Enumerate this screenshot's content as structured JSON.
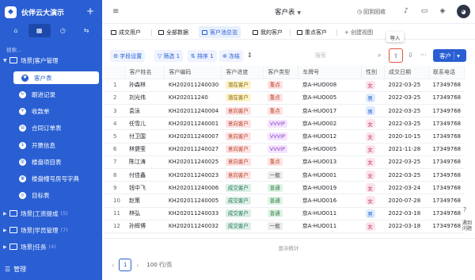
{
  "sidebar": {
    "brand": "伙伴云大演示",
    "logo_glyph": "◆",
    "plus": "+",
    "search_placeholder": "搜索...",
    "tabs": [
      {
        "icon": "home-icon",
        "glyph": "⌂"
      },
      {
        "icon": "table-icon",
        "glyph": "▦",
        "active": true
      },
      {
        "icon": "clock-icon",
        "glyph": "◷"
      },
      {
        "icon": "flow-icon",
        "glyph": "⇆"
      }
    ],
    "groups": [
      {
        "label": "场景|客户管理",
        "count": ""
      },
      {
        "label": "场景|工资提成",
        "count": "(5)"
      },
      {
        "label": "场景|学员管理",
        "count": "(7)"
      },
      {
        "label": "场景|任务",
        "count": "(4)"
      }
    ],
    "items": [
      {
        "label": "客户表",
        "icon": "heart-icon",
        "glyph": "♥"
      },
      {
        "label": "跟进记录",
        "icon": "refresh-icon",
        "glyph": "↻"
      },
      {
        "label": "收款单",
        "icon": "money-icon",
        "glyph": "¥"
      },
      {
        "label": "合同订单表",
        "icon": "document-icon",
        "glyph": "▤"
      },
      {
        "label": "开票信息",
        "icon": "invoice-icon",
        "glyph": "$"
      },
      {
        "label": "楼盘项目表",
        "icon": "building-icon",
        "glyph": "▥"
      },
      {
        "label": "楼盘幢号房号字典",
        "icon": "dictionary-icon",
        "glyph": "▦"
      },
      {
        "label": "目标表",
        "icon": "target-icon",
        "glyph": "◎"
      }
    ],
    "footer": "管理"
  },
  "topbar": {
    "title": "客户表",
    "recycle": "回到回收",
    "avatar": "◕"
  },
  "view_tabs": [
    "成交用户",
    "全部数据",
    "客户池总览",
    "我的客户",
    "重点客户",
    "+ 创建视图"
  ],
  "toolbar": {
    "field_settings": "字段设置",
    "filter": "筛选 1",
    "sort": "排序 1",
    "freeze": "冻结",
    "search_placeholder": "搜索",
    "import_tooltip": "导入",
    "customer_button": "客户"
  },
  "table": {
    "columns": [
      "",
      "客户姓名",
      "客户编码",
      "客户进度",
      "客户类型",
      "车牌号",
      "性别",
      "成交日期",
      "联系电话"
    ],
    "rows": [
      [
        "1",
        "孙森林",
        "KH202011240030",
        "潜在客户",
        "重点",
        "京A-HUO008",
        "女",
        "2022-03-25",
        "17349768"
      ],
      [
        "2",
        "刘光伟",
        "KH202011240",
        "潜在客户",
        "重点",
        "京A-HUO005",
        "男",
        "2022-03-25",
        "17349768"
      ],
      [
        "3",
        "袁泳",
        "KH202011240004",
        "意向客户",
        "重点",
        "京A-HUO017",
        "男",
        "2022-03-25",
        "17349768"
      ],
      [
        "4",
        "任雪儿",
        "KH202011240001",
        "意向客户",
        "VVVIP",
        "京A-HUO002",
        "女",
        "2022-03-25",
        "17349768"
      ],
      [
        "5",
        "付卫国",
        "KH202011240007",
        "意向客户",
        "VVVIP",
        "京A-HUO012",
        "女",
        "2020-10-15",
        "17349768"
      ],
      [
        "6",
        "林健莹",
        "KH202011240027",
        "意向客户",
        "VVVIP",
        "京A-HUO005",
        "女",
        "2021-11-28",
        "17349768"
      ],
      [
        "7",
        "陈江涛",
        "KH202011240025",
        "意向客户",
        "重点",
        "京A-HUO013",
        "女",
        "2022-03-25",
        "17349768"
      ],
      [
        "8",
        "付佳鑫",
        "KH202011240023",
        "意向客户",
        "一般",
        "京A-HUO001",
        "女",
        "2022-03-25",
        "17349768"
      ],
      [
        "9",
        "钱中飞",
        "KH202011240006",
        "成交客户",
        "普通",
        "京A-HUO019",
        "女",
        "2022-03-24",
        "17349768"
      ],
      [
        "10",
        "赵策",
        "KH202011240005",
        "成交客户",
        "普通",
        "京A-HUO016",
        "女",
        "2020-07-28",
        "17349768"
      ],
      [
        "11",
        "林弘",
        "KH202011240033",
        "成交客户",
        "普通",
        "京A-HUO011",
        "男",
        "2022-03-18",
        "17349768"
      ],
      [
        "12",
        "孙辉博",
        "KH202011240032",
        "成交客户",
        "一般",
        "京A-HUO011",
        "女",
        "2022-03-18",
        "17349768"
      ]
    ]
  },
  "colors": {
    "progress": {
      "潜在客户": [
        "#fdf3c9",
        "#8a6a0b"
      ],
      "意向客户": [
        "#fde2e2",
        "#b8472f"
      ],
      "成交客户": [
        "#dcefe6",
        "#2a7a5a"
      ]
    },
    "type": {
      "重点": [
        "#fde2e2",
        "#b8472f"
      ],
      "VVVIP": [
        "#f3e3ff",
        "#8a3fbf"
      ],
      "一般": [
        "#ececec",
        "#444"
      ],
      "普通": [
        "#dff3e3",
        "#2a7a4a"
      ]
    },
    "gender": {
      "女": [
        "#fde2ec",
        "#b83a66"
      ],
      "男": [
        "#dde9ff",
        "#2a5fd3"
      ]
    }
  },
  "footer": {
    "stats": "显示统计",
    "page": "1",
    "page_size": "100 行/页"
  },
  "help": {
    "label": "?",
    "feedback": "遇到问题"
  }
}
